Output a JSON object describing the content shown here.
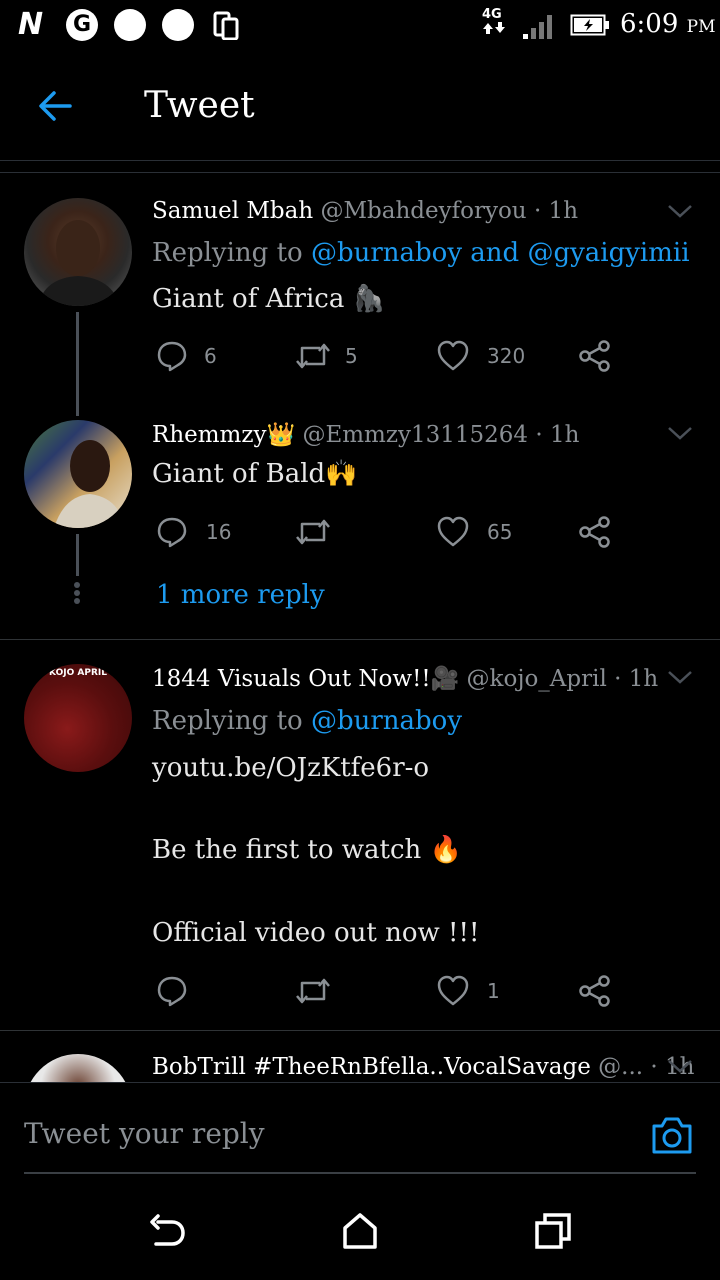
{
  "status_bar": {
    "time": "6:09",
    "ampm": "PM",
    "network": "4G",
    "notif_g": "G"
  },
  "header": {
    "title": "Tweet"
  },
  "tweets": [
    {
      "name": "Samuel Mbah",
      "handle": "@Mbahdeyforyou",
      "time": "· 1h",
      "replying_prefix": "Replying to",
      "replying_to_1": "@burnaboy",
      "replying_and": "and",
      "replying_to_2": "@gyaigyimii",
      "text": "Giant of Africa",
      "text_emoji": "🦍",
      "replies": "6",
      "retweets": "5",
      "likes": "320"
    },
    {
      "name": "Rhemmzy",
      "name_emoji": "👑",
      "handle": "@Emmzy13115264",
      "time": "· 1h",
      "text": "Giant of Bald",
      "text_emoji": "🙌",
      "replies": "16",
      "retweets": "",
      "likes": "65",
      "more_replies": "1 more reply"
    },
    {
      "name": "1844 Visuals Out Now!!",
      "name_emoji": "🎥",
      "handle": "@kojo_April",
      "time": "· 1h",
      "avatar_text": "KOJO APRIL",
      "replying_prefix": "Replying to",
      "replying_to_1": "@burnaboy",
      "link": "youtu.be/OJzKtfe6r-o",
      "line1": "Be the first to watch",
      "line1_emoji": "🔥",
      "line2": "Official video out now !!!",
      "replies": "",
      "retweets": "",
      "likes": "1"
    },
    {
      "name": "BobTrill #TheeRnBfella..VocalSavage",
      "handle": "@...",
      "time": "· 1h"
    }
  ],
  "reply_box": {
    "placeholder": "Tweet your reply"
  },
  "colors": {
    "accent": "#1d9bf0",
    "background": "#000000",
    "muted": "#8a8f94"
  }
}
